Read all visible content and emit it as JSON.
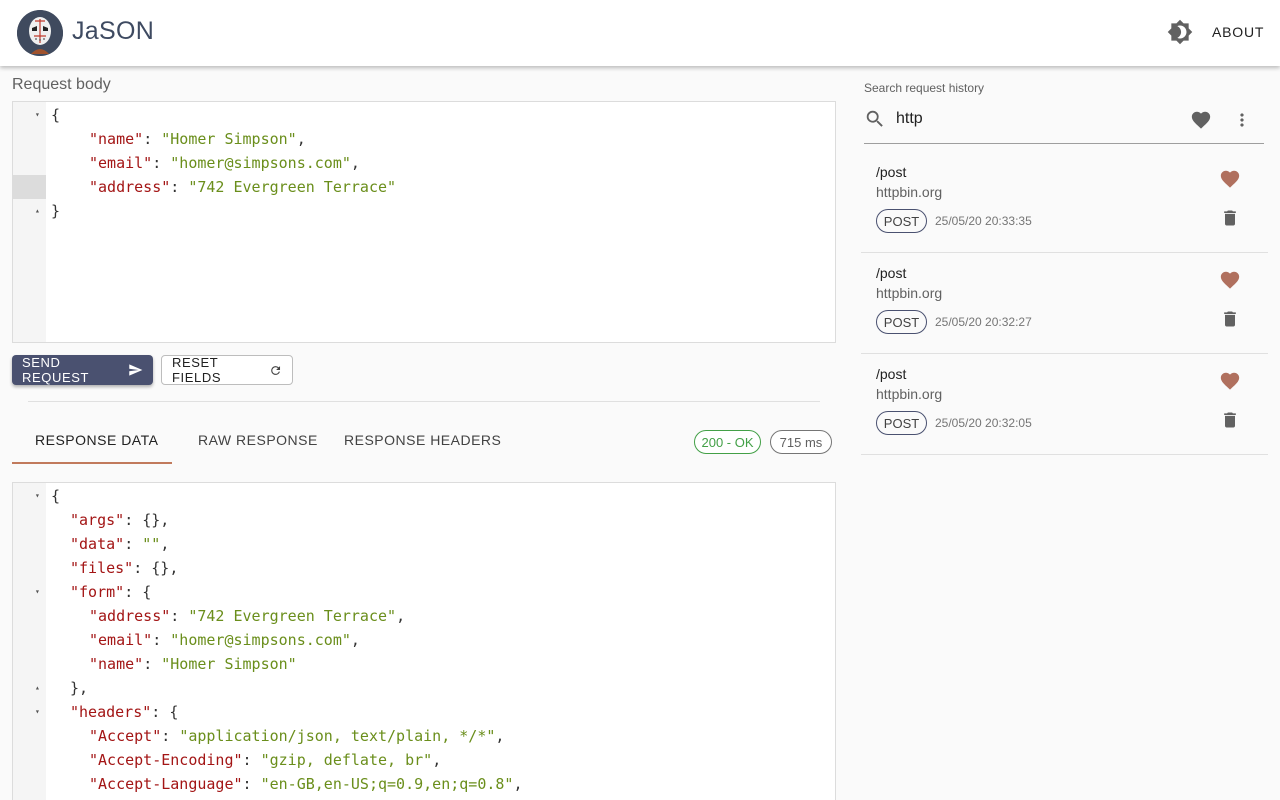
{
  "app": {
    "title": "JaSON",
    "about_label": "ABOUT",
    "icons": {
      "logo": "jason-mask-logo",
      "theme": "brightness-icon"
    }
  },
  "request": {
    "label": "Request body",
    "lines": [
      {
        "indent": 0,
        "fold": "▾",
        "parts": [
          [
            "p",
            "{"
          ]
        ]
      },
      {
        "indent": 4,
        "parts": [
          [
            "k",
            "\"name\""
          ],
          [
            "p",
            ": "
          ],
          [
            "s",
            "\"Homer Simpson\""
          ],
          [
            "p",
            ","
          ]
        ]
      },
      {
        "indent": 4,
        "parts": [
          [
            "k",
            "\"email\""
          ],
          [
            "p",
            ": "
          ],
          [
            "s",
            "\"homer@simpsons.com\""
          ],
          [
            "p",
            ","
          ]
        ]
      },
      {
        "indent": 4,
        "active": true,
        "parts": [
          [
            "k",
            "\"address\""
          ],
          [
            "p",
            ": "
          ],
          [
            "s",
            "\"742 Evergreen Terrace\""
          ]
        ]
      },
      {
        "indent": 0,
        "fold": "▴",
        "parts": [
          [
            "p",
            "}"
          ]
        ]
      }
    ]
  },
  "actions": {
    "send_label": "SEND REQUEST",
    "reset_label": "RESET FIELDS"
  },
  "response": {
    "tabs": [
      "RESPONSE DATA",
      "RAW RESPONSE",
      "RESPONSE HEADERS"
    ],
    "active_tab": "RESPONSE DATA",
    "status": "200 - OK",
    "time": "715 ms",
    "lines": [
      {
        "indent": 0,
        "fold": "▾",
        "parts": [
          [
            "p",
            "{"
          ]
        ]
      },
      {
        "indent": 2,
        "parts": [
          [
            "k",
            "\"args\""
          ],
          [
            "p",
            ": {},"
          ]
        ]
      },
      {
        "indent": 2,
        "parts": [
          [
            "k",
            "\"data\""
          ],
          [
            "p",
            ": "
          ],
          [
            "s",
            "\"\""
          ],
          [
            "p",
            ","
          ]
        ]
      },
      {
        "indent": 2,
        "parts": [
          [
            "k",
            "\"files\""
          ],
          [
            "p",
            ": {},"
          ]
        ]
      },
      {
        "indent": 2,
        "fold": "▾",
        "parts": [
          [
            "k",
            "\"form\""
          ],
          [
            "p",
            ": {"
          ]
        ]
      },
      {
        "indent": 4,
        "parts": [
          [
            "k",
            "\"address\""
          ],
          [
            "p",
            ": "
          ],
          [
            "s",
            "\"742 Evergreen Terrace\""
          ],
          [
            "p",
            ","
          ]
        ]
      },
      {
        "indent": 4,
        "parts": [
          [
            "k",
            "\"email\""
          ],
          [
            "p",
            ": "
          ],
          [
            "s",
            "\"homer@simpsons.com\""
          ],
          [
            "p",
            ","
          ]
        ]
      },
      {
        "indent": 4,
        "parts": [
          [
            "k",
            "\"name\""
          ],
          [
            "p",
            ": "
          ],
          [
            "s",
            "\"Homer Simpson\""
          ]
        ]
      },
      {
        "indent": 2,
        "fold": "▴",
        "parts": [
          [
            "p",
            "},"
          ]
        ]
      },
      {
        "indent": 2,
        "fold": "▾",
        "parts": [
          [
            "k",
            "\"headers\""
          ],
          [
            "p",
            ": {"
          ]
        ]
      },
      {
        "indent": 4,
        "parts": [
          [
            "k",
            "\"Accept\""
          ],
          [
            "p",
            ": "
          ],
          [
            "s",
            "\"application/json, text/plain, */*\""
          ],
          [
            "p",
            ","
          ]
        ]
      },
      {
        "indent": 4,
        "parts": [
          [
            "k",
            "\"Accept-Encoding\""
          ],
          [
            "p",
            ": "
          ],
          [
            "s",
            "\"gzip, deflate, br\""
          ],
          [
            "p",
            ","
          ]
        ]
      },
      {
        "indent": 4,
        "parts": [
          [
            "k",
            "\"Accept-Language\""
          ],
          [
            "p",
            ": "
          ],
          [
            "s",
            "\"en-GB,en-US;q=0.9,en;q=0.8\""
          ],
          [
            "p",
            ","
          ]
        ]
      }
    ]
  },
  "history": {
    "search_label": "Search request history",
    "search_value": "http",
    "items": [
      {
        "path": "/post",
        "host": "httpbin.org",
        "method": "POST",
        "time": "25/05/20 20:33:35"
      },
      {
        "path": "/post",
        "host": "httpbin.org",
        "method": "POST",
        "time": "25/05/20 20:32:27"
      },
      {
        "path": "/post",
        "host": "httpbin.org",
        "method": "POST",
        "time": "25/05/20 20:32:05"
      }
    ]
  },
  "colors": {
    "primary": "#4a5170",
    "accent": "#c17a5c",
    "success": "#43a047",
    "heart": "#b0705e"
  }
}
